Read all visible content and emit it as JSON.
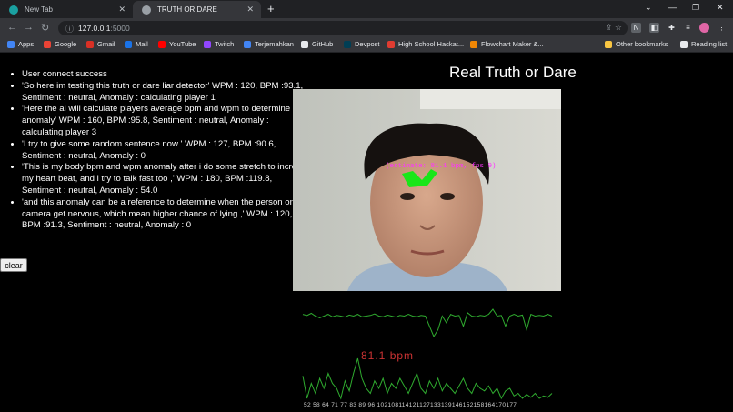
{
  "browser": {
    "tabs": [
      {
        "title": "New Tab",
        "active": false,
        "favicon_color": "#1aa0a0"
      },
      {
        "title": "TRUTH OR DARE",
        "active": true,
        "favicon_color": "#9aa0a6"
      }
    ],
    "address": {
      "host": "127.0.0.1",
      "port": ":5000"
    },
    "bookmarks": [
      {
        "label": "Apps",
        "icon": "apps-grid-icon",
        "color": "#4285f4"
      },
      {
        "label": "Google",
        "icon": "google-icon",
        "color": "#ea4335"
      },
      {
        "label": "Gmail",
        "icon": "gmail-icon",
        "color": "#d93025"
      },
      {
        "label": "Mail",
        "icon": "mail-icon",
        "color": "#1a73e8"
      },
      {
        "label": "YouTube",
        "icon": "youtube-icon",
        "color": "#ff0000"
      },
      {
        "label": "Twitch",
        "icon": "twitch-icon",
        "color": "#9146ff"
      },
      {
        "label": "Terjemahkan",
        "icon": "translate-icon",
        "color": "#4285f4"
      },
      {
        "label": "GitHub",
        "icon": "github-icon",
        "color": "#e8eaed"
      },
      {
        "label": "Devpost",
        "icon": "devpost-icon",
        "color": "#003e54"
      },
      {
        "label": "High School Hackat...",
        "icon": "hackathon-icon",
        "color": "#e03c31"
      },
      {
        "label": "Flowchart Maker &...",
        "icon": "flowchart-icon",
        "color": "#f08705"
      },
      {
        "label": "Other bookmarks",
        "icon": "folder-icon",
        "color": "#f9c642"
      },
      {
        "label": "Reading list",
        "icon": "reading-list-icon",
        "color": "#e8eaed"
      }
    ]
  },
  "page": {
    "title": "Real Truth or Dare",
    "log": [
      "User connect success",
      "'So here im testing this truth or dare liar detector' WPM : 120, BPM :93.1, Sentiment : neutral, Anomaly : calculating player 1",
      "'Here the ai will calculate players average bpm and wpm to determine next anomaly' WPM : 160, BPM :95.8, Sentiment : neutral, Anomaly : calculating player 3",
      "'I try to give some random sentence now ' WPM : 127, BPM :90.6, Sentiment : neutral, Anomaly : 0",
      "'This is my body bpm and wpm anomaly after i do some stretch to increase my heart beat, and i try to talk fast too ,' WPM : 180, BPM :119.8, Sentiment : neutral, Anomaly : 54.0",
      "'and this anomaly can be a reference to determine when the person on camera get nervous, which mean higher chance of lying ,' WPM : 120, BPM :91.3, Sentiment : neutral, Anomaly : 0"
    ],
    "clear_label": "clear",
    "video_overlay": "(estimate: 81.1 bpm, fps 9)",
    "bpm_label": "81.1 bpm",
    "tick_labels": "52 58 64 71 77 83 89 96 102108114121127133139146152158164170177",
    "chart_data": [
      {
        "type": "line",
        "series": [
          {
            "values": [
              0.55,
              0.52,
              0.58,
              0.5,
              0.45,
              0.5,
              0.55,
              0.48,
              0.52,
              0.5,
              0.47,
              0.53,
              0.5,
              0.55,
              0.48,
              0.5,
              0.52,
              0.56,
              0.5,
              0.48,
              0.53,
              0.5,
              0.47,
              0.52,
              0.5,
              0.55,
              0.5,
              0.48,
              0.52,
              0.5,
              0.2,
              -0.1,
              0.1,
              0.5,
              0.3,
              0.55,
              0.5,
              0.52,
              0.2,
              0.6,
              0.5,
              0.48,
              0.52,
              0.5,
              0.55,
              0.7,
              0.5,
              0.52,
              0.2,
              0.5,
              0.55,
              0.5,
              0.53,
              0.1,
              0.55,
              0.5,
              0.52,
              0.5,
              0.55,
              0.5
            ]
          }
        ]
      },
      {
        "type": "line",
        "series": [
          {
            "values": [
              0.55,
              0.1,
              0.4,
              0.2,
              0.5,
              0.3,
              0.6,
              0.4,
              0.3,
              0.1,
              0.45,
              0.25,
              0.6,
              0.9,
              0.5,
              0.3,
              0.2,
              0.45,
              0.3,
              0.5,
              0.2,
              0.4,
              0.3,
              0.5,
              0.35,
              0.2,
              0.4,
              0.6,
              0.3,
              0.2,
              0.45,
              0.3,
              0.5,
              0.25,
              0.4,
              0.3,
              0.2,
              0.35,
              0.5,
              0.3,
              0.2,
              0.4,
              0.3,
              0.25,
              0.35,
              0.2,
              0.3,
              0.1,
              0.25,
              0.3,
              0.15,
              0.2,
              0.1,
              0.18,
              0.12,
              0.2,
              0.1,
              0.15,
              0.12,
              0.2
            ]
          }
        ]
      }
    ]
  }
}
